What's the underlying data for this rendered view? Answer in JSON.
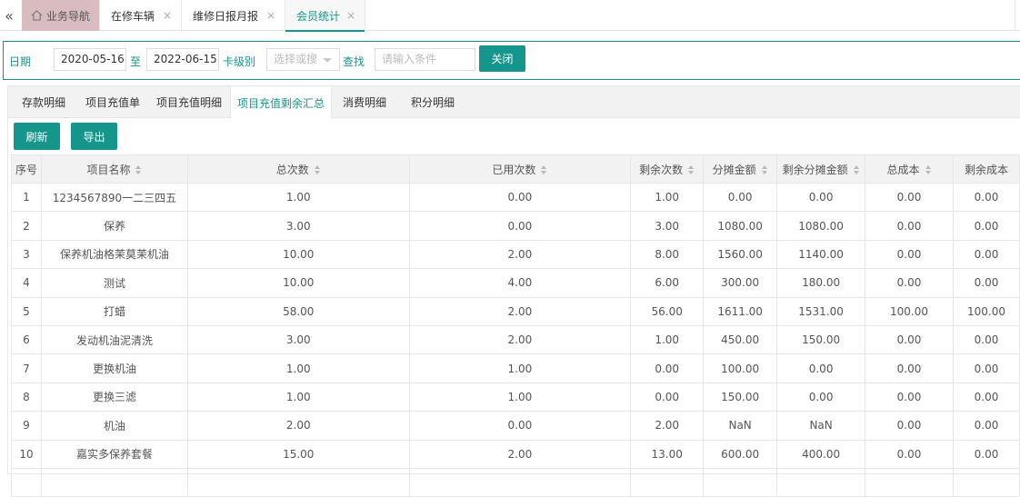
{
  "topbar": {
    "collapse_glyph": "«",
    "tabs": [
      {
        "label": "业务导航",
        "icon": "home-icon"
      },
      {
        "label": "在修车辆",
        "close": "×"
      },
      {
        "label": "维修日报月报",
        "close": "×"
      },
      {
        "label": "会员统计",
        "close": "×"
      }
    ]
  },
  "search": {
    "date_label": "日期",
    "date_from": "2020-05-16",
    "to_label": "至",
    "date_to": "2022-06-15",
    "card_type_label": "卡级别",
    "card_type_placeholder": "选择或搜",
    "find_label": "查找",
    "condition_placeholder": "请输入条件",
    "close_button": "关闭"
  },
  "subtabs": [
    "存款明细",
    "项目充值单",
    "项目充值明细",
    "项目充值剩余汇总",
    "消费明细",
    "积分明细"
  ],
  "active_subtab": "项目充值剩余汇总",
  "toolbar": {
    "refresh": "刷新",
    "export": "导出"
  },
  "table": {
    "headers": [
      "序号",
      "项目名称",
      "总次数",
      "已用次数",
      "剩余次数",
      "分摊金额",
      "剩余分摊金额",
      "总成本",
      "剩余成本"
    ],
    "rows": [
      [
        "1",
        "1234567890一二三四五",
        "1.00",
        "0.00",
        "1.00",
        "0.00",
        "0.00",
        "0.00",
        "0.00"
      ],
      [
        "2",
        "保养",
        "3.00",
        "0.00",
        "3.00",
        "1080.00",
        "1080.00",
        "0.00",
        "0.00"
      ],
      [
        "3",
        "保养机油格茉莫茉机油",
        "10.00",
        "2.00",
        "8.00",
        "1560.00",
        "1140.00",
        "0.00",
        "0.00"
      ],
      [
        "4",
        "测试",
        "10.00",
        "4.00",
        "6.00",
        "300.00",
        "180.00",
        "0.00",
        "0.00"
      ],
      [
        "5",
        "打蜡",
        "58.00",
        "2.00",
        "56.00",
        "1611.00",
        "1531.00",
        "100.00",
        "100.00"
      ],
      [
        "6",
        "发动机油泥清洗",
        "3.00",
        "2.00",
        "1.00",
        "450.00",
        "150.00",
        "0.00",
        "0.00"
      ],
      [
        "7",
        "更换机油",
        "1.00",
        "1.00",
        "0.00",
        "100.00",
        "0.00",
        "0.00",
        "0.00"
      ],
      [
        "8",
        "更换三滤",
        "1.00",
        "1.00",
        "0.00",
        "150.00",
        "0.00",
        "0.00",
        "0.00"
      ],
      [
        "9",
        "机油",
        "2.00",
        "0.00",
        "2.00",
        "NaN",
        "NaN",
        "0.00",
        "0.00"
      ],
      [
        "10",
        "嘉实多保养套餐",
        "15.00",
        "2.00",
        "13.00",
        "600.00",
        "400.00",
        "0.00",
        "0.00"
      ]
    ]
  },
  "colors": {
    "accent": "#14968c",
    "home_tab_bg": "#d9bcc0"
  }
}
